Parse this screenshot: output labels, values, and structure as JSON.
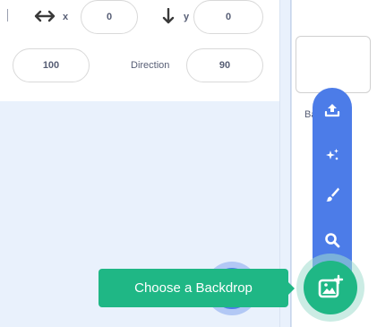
{
  "sprite_info": {
    "x_label": "x",
    "x_value": "0",
    "y_label": "y",
    "y_value": "0",
    "size_value": "100",
    "direction_label": "Direction",
    "direction_value": "90"
  },
  "stage_panel": {
    "backdrops_label": "Backdrops"
  },
  "backdrop_menu": {
    "items": [
      {
        "icon": "upload-icon"
      },
      {
        "icon": "surprise-icon"
      },
      {
        "icon": "paint-icon"
      },
      {
        "icon": "search-icon"
      }
    ],
    "tooltip": "Choose a Backdrop",
    "main_icon": "choose-backdrop-icon"
  },
  "colors": {
    "menu_blue": "#4c7ce8",
    "action_green": "#1fb785",
    "panel_bg": "#e9f1fc"
  }
}
